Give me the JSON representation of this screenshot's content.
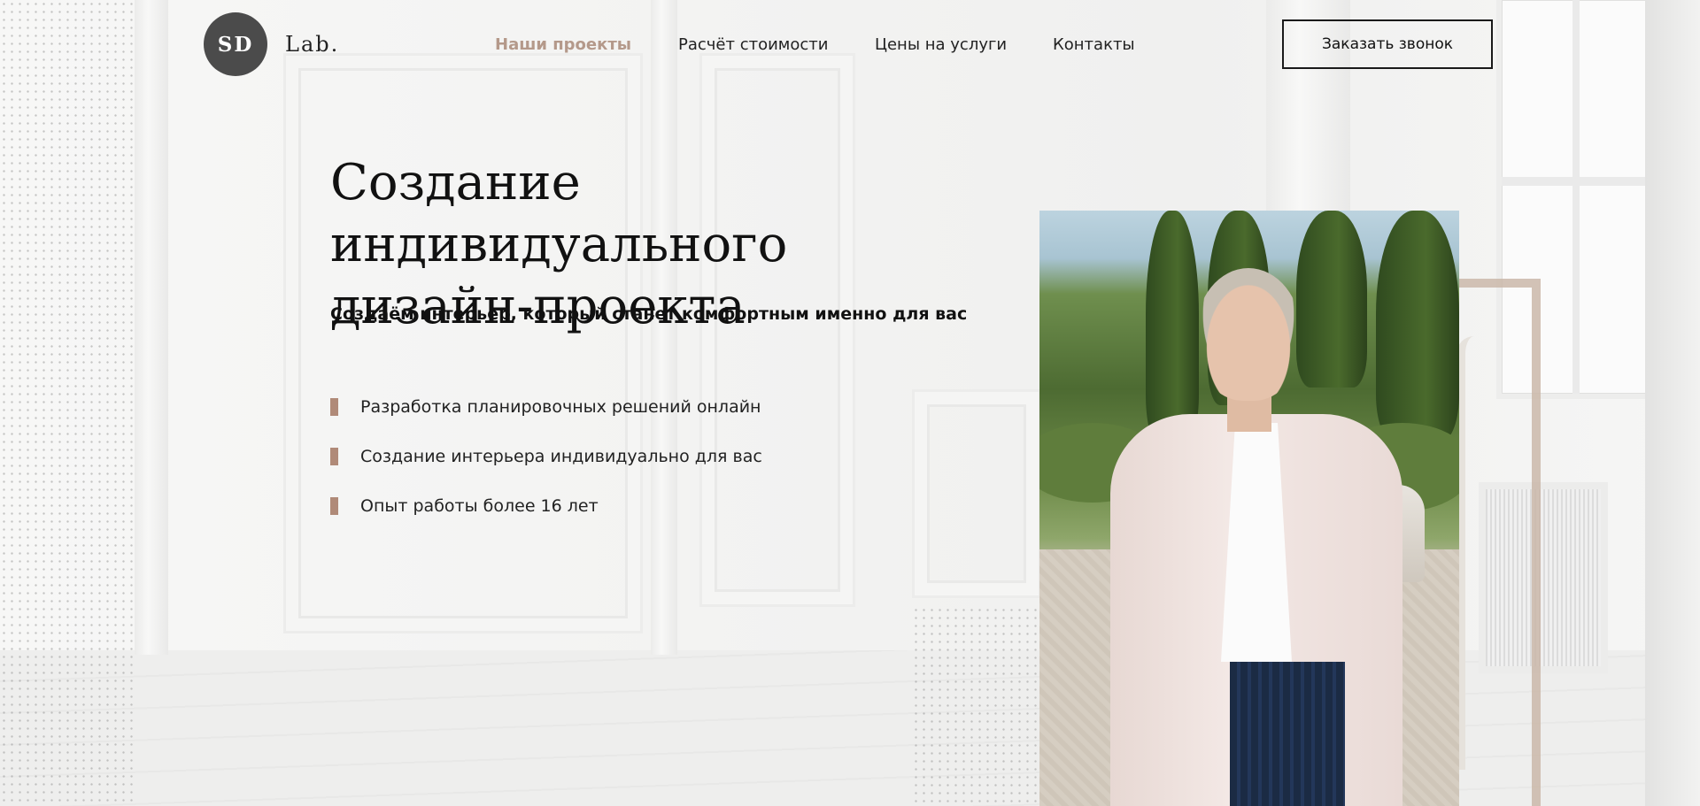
{
  "brand": {
    "monogram": "SD",
    "name": "Lab."
  },
  "nav": {
    "items": [
      {
        "label": "Наши проекты",
        "active": true
      },
      {
        "label": "Расчёт стоимости",
        "active": false
      },
      {
        "label": "Цены на услуги",
        "active": false
      },
      {
        "label": "Контакты",
        "active": false
      }
    ]
  },
  "cta": {
    "label": "Заказать звонок"
  },
  "hero": {
    "title_line1": "Создание индивидуального",
    "title_line2": "дизайн-проекта",
    "subtitle": "Создаём интерьер, который станет комфортным именно для вас",
    "features": [
      "Разработка планировочных решений онлайн",
      "Создание интерьера индивидуально для вас",
      "Опыт работы более 16 лет"
    ]
  },
  "colors": {
    "accent": "#b4998a",
    "bullet": "#b08a78",
    "logo_bg": "#4b4b4b",
    "text": "#111111"
  }
}
